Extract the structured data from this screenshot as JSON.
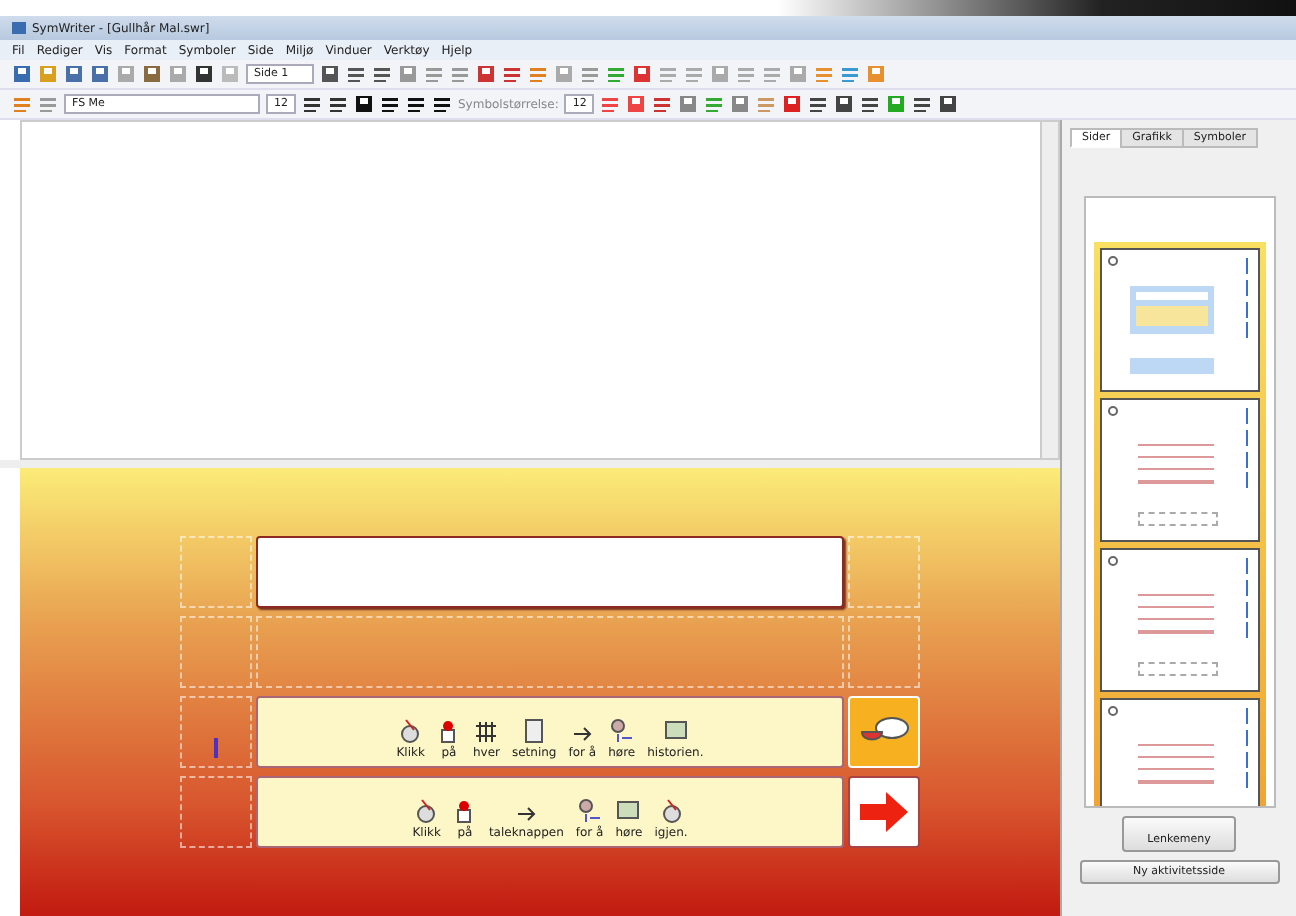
{
  "window": {
    "title": "SymWriter - [Gullhår Mal.swr]"
  },
  "menu": [
    "Fil",
    "Rediger",
    "Vis",
    "Format",
    "Symboler",
    "Side",
    "Miljø",
    "Vinduer",
    "Verktøy",
    "Hjelp"
  ],
  "toolbar": {
    "page_field": "Side 1",
    "font": "FS Me",
    "font_size": "12",
    "symbol_size_label": "Symbolstørrelse:",
    "symbol_size": "12"
  },
  "activity": {
    "rows": [
      {
        "kind": "title"
      },
      {
        "kind": "empty"
      },
      {
        "kind": "sentence",
        "cursor": true,
        "words": [
          "Klikk",
          "på",
          "hver",
          "setning",
          "for å",
          "høre",
          "historien."
        ],
        "button": {
          "kind": "speech"
        }
      },
      {
        "kind": "sentence",
        "cursor": false,
        "words": [
          "Klikk",
          "på",
          "taleknappen",
          "for å",
          "høre",
          "igjen."
        ],
        "button": {
          "kind": "next"
        }
      }
    ]
  },
  "side_panel": {
    "tabs": [
      {
        "label": "Sider",
        "selected": true
      },
      {
        "label": "Grafikk",
        "selected": false
      },
      {
        "label": "Symboler",
        "selected": false
      }
    ],
    "pages": [
      {
        "kind": "current"
      },
      {
        "kind": "template"
      },
      {
        "kind": "template"
      },
      {
        "kind": "template"
      }
    ],
    "buttons": [
      "Lenkemeny",
      "Ny aktivitetsside"
    ]
  }
}
